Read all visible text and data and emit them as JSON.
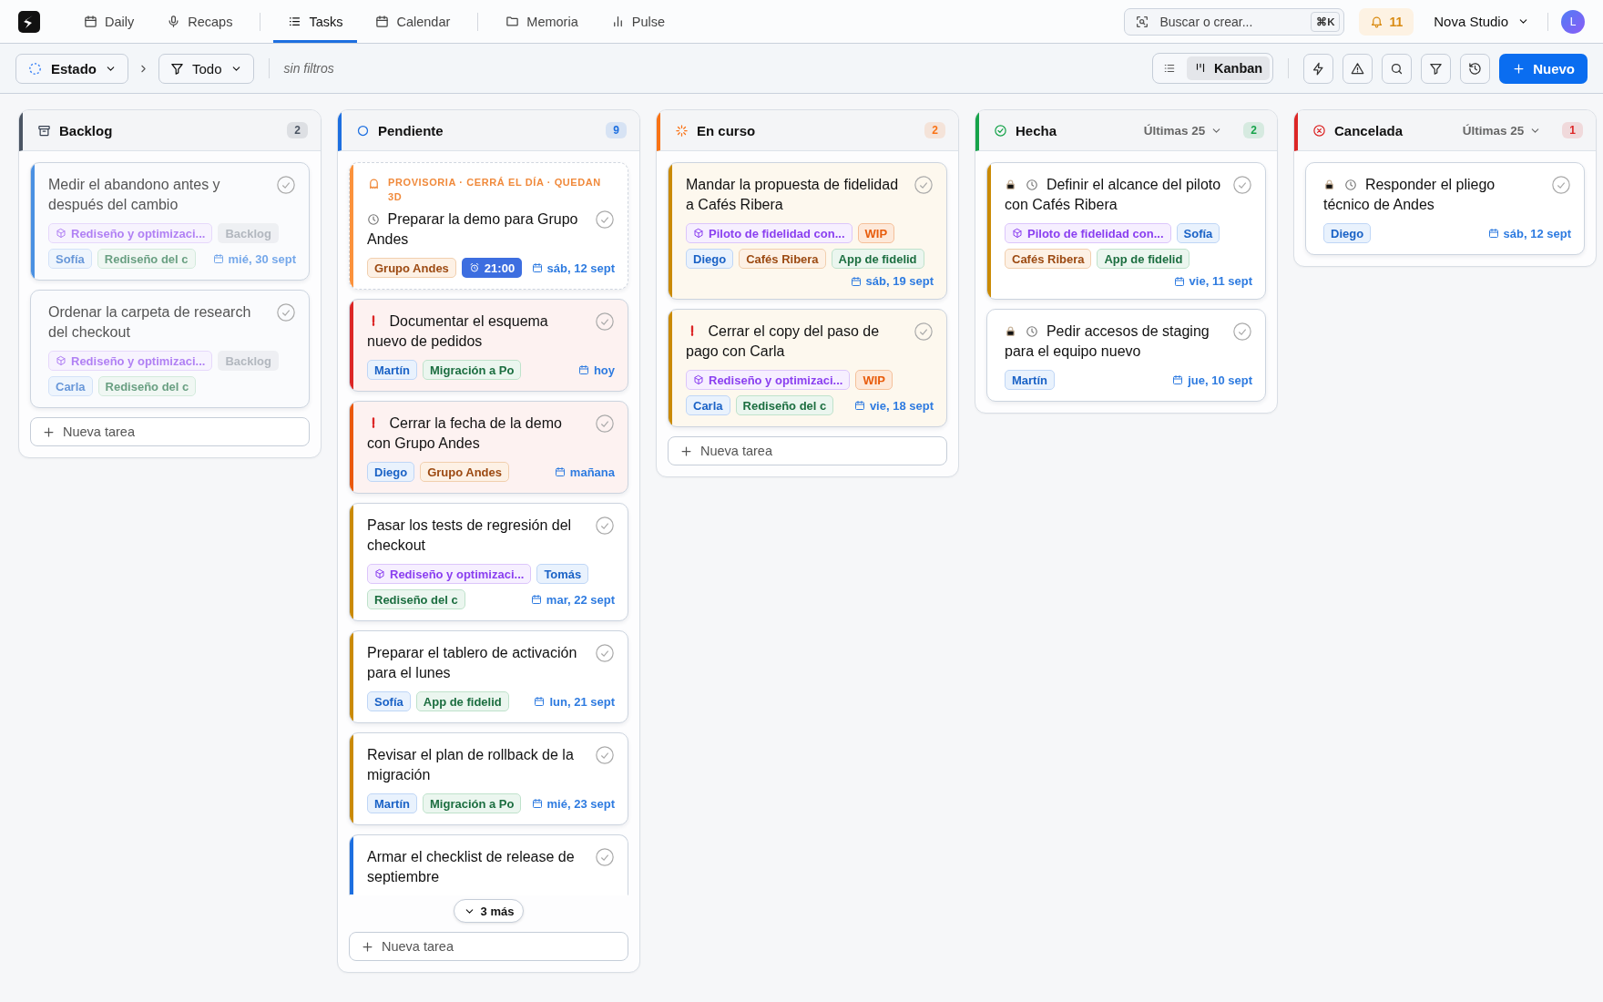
{
  "nav": {
    "tab_groups": [
      {
        "tabs": [
          {
            "label": "Daily",
            "kind": "calendar",
            "selected": false
          },
          {
            "label": "Recaps",
            "kind": "microphone",
            "selected": false
          }
        ]
      },
      {
        "tabs": [
          {
            "label": "Tasks",
            "kind": "list",
            "selected": true
          },
          {
            "label": "Calendar",
            "kind": "calendar",
            "selected": false
          }
        ]
      },
      {
        "tabs": [
          {
            "label": "Memoria",
            "kind": "folder",
            "selected": false
          },
          {
            "label": "Pulse",
            "kind": "bar-chart",
            "selected": false
          }
        ]
      }
    ],
    "search": {
      "placeholder": "Buscar o crear...",
      "shortcut": "⌘K"
    },
    "notifications": "11",
    "workspace": "Nova Studio",
    "avatar": "L"
  },
  "toolbar": {
    "state_picker": "Estado",
    "filter": "Todo",
    "filter_note": "sin filtros",
    "views": [
      {
        "kind": "list",
        "selected": false
      },
      {
        "kind": "kanban",
        "label": "Kanban",
        "selected": true
      }
    ],
    "new_button": "Nuevo"
  },
  "columns": [
    {
      "kind": "backlog",
      "title": "Backlog",
      "color": "#4b5563",
      "count": "2",
      "new_task": "Nueva tarea",
      "cards": [
        {
          "kind": "muted",
          "color": "#4a90e2",
          "urgent": false,
          "locked": false,
          "scheduled": false,
          "title": "Medir el abandono antes y después del cambio",
          "tags": [
            {
              "kind": "project",
              "label": "Rediseño y optimizaci..."
            },
            {
              "kind": "status",
              "label": "Backlog"
            },
            {
              "kind": "person",
              "label": "Sofía"
            },
            {
              "kind": "area",
              "label": "Rediseño del c"
            }
          ],
          "due": "mié, 30 sept"
        },
        {
          "kind": "muted",
          "urgent": false,
          "locked": false,
          "scheduled": false,
          "title": "Ordenar la carpeta de research del checkout",
          "tags": [
            {
              "kind": "project",
              "label": "Rediseño y optimizaci..."
            },
            {
              "kind": "status",
              "label": "Backlog"
            },
            {
              "kind": "person",
              "label": "Carla"
            },
            {
              "kind": "area",
              "label": "Rediseño del c"
            }
          ]
        }
      ]
    },
    {
      "kind": "pending",
      "title": "Pendiente",
      "color": "#1d6fe0",
      "count": "9",
      "more": "3 más",
      "new_task": "Nueva tarea",
      "cards": [
        {
          "kind": "provisional",
          "color": "#fb923c",
          "banner": "PROVISORIA · CERRÁ EL DÍA · QUEDAN 3D",
          "urgent": false,
          "locked": false,
          "scheduled": true,
          "title": "Preparar la demo para Grupo Andes",
          "tags": [
            {
              "kind": "client",
              "label": "Grupo Andes"
            },
            {
              "kind": "time",
              "label": "21:00"
            }
          ],
          "due": "sáb, 12 sept"
        },
        {
          "kind": "urgent",
          "color": "#dc2626",
          "urgent": true,
          "locked": false,
          "scheduled": false,
          "title": "Documentar el esquema nuevo de pedidos",
          "tags": [
            {
              "kind": "person",
              "label": "Martín"
            },
            {
              "kind": "area",
              "label": "Migración a Po"
            }
          ],
          "due": "hoy"
        },
        {
          "kind": "urgent",
          "color": "#ea580c",
          "urgent": true,
          "locked": false,
          "scheduled": false,
          "title": "Cerrar la fecha de la demo con Grupo Andes",
          "tags": [
            {
              "kind": "person",
              "label": "Diego"
            },
            {
              "kind": "client",
              "label": "Grupo Andes"
            }
          ],
          "due": "mañana"
        },
        {
          "kind": "plain",
          "color": "#ca8a04",
          "urgent": false,
          "locked": false,
          "scheduled": false,
          "title": "Pasar los tests de regresión del checkout",
          "tags": [
            {
              "kind": "project",
              "label": "Rediseño y optimizaci..."
            },
            {
              "kind": "person",
              "label": "Tomás"
            },
            {
              "kind": "area",
              "label": "Rediseño del c"
            }
          ],
          "due": "mar, 22 sept"
        },
        {
          "kind": "plain",
          "color": "#ca8a04",
          "urgent": false,
          "locked": false,
          "scheduled": false,
          "title": "Preparar el tablero de activación para el lunes",
          "tags": [
            {
              "kind": "person",
              "label": "Sofía"
            },
            {
              "kind": "area",
              "label": "App de fidelid"
            }
          ],
          "due": "lun, 21 sept"
        },
        {
          "kind": "plain",
          "color": "#ca8a04",
          "urgent": false,
          "locked": false,
          "scheduled": false,
          "title": "Revisar el plan de rollback de la migración",
          "tags": [
            {
              "kind": "person",
              "label": "Martín"
            },
            {
              "kind": "area",
              "label": "Migración a Po"
            }
          ],
          "due": "mié, 23 sept"
        },
        {
          "kind": "plain",
          "color": "#1d6fe0",
          "urgent": false,
          "locked": false,
          "scheduled": false,
          "title": "Armar el checklist de release de septiembre"
        }
      ]
    },
    {
      "kind": "progress",
      "title": "En curso",
      "color": "#f97316",
      "count": "2",
      "new_task": "Nueva tarea",
      "cards": [
        {
          "kind": "progress",
          "color": "#ca8a04",
          "urgent": false,
          "locked": false,
          "scheduled": false,
          "title": "Mandar la propuesta de fidelidad a Cafés Ribera",
          "tags": [
            {
              "kind": "project",
              "label": "Piloto de fidelidad con..."
            },
            {
              "kind": "wip",
              "label": "WIP"
            },
            {
              "kind": "person",
              "label": "Diego"
            },
            {
              "kind": "client",
              "label": "Cafés Ribera"
            },
            {
              "kind": "area",
              "label": "App de fidelid"
            }
          ],
          "due": "sáb, 19 sept"
        },
        {
          "kind": "progress",
          "color": "#ca8a04",
          "urgent": true,
          "locked": false,
          "scheduled": false,
          "title": "Cerrar el copy del paso de pago con Carla",
          "tags": [
            {
              "kind": "project",
              "label": "Rediseño y optimizaci..."
            },
            {
              "kind": "wip",
              "label": "WIP"
            },
            {
              "kind": "person",
              "label": "Carla"
            },
            {
              "kind": "area",
              "label": "Rediseño del c"
            }
          ],
          "due": "vie, 18 sept"
        }
      ]
    },
    {
      "kind": "done",
      "title": "Hecha",
      "color": "#16a34a",
      "range": "Últimas 25",
      "count": "2",
      "cards": [
        {
          "kind": "plain",
          "color": "#ca8a04",
          "urgent": false,
          "locked": true,
          "scheduled": true,
          "title": "Definir el alcance del piloto con Cafés Ribera",
          "tags": [
            {
              "kind": "project",
              "label": "Piloto de fidelidad con..."
            },
            {
              "kind": "person",
              "label": "Sofía"
            },
            {
              "kind": "client",
              "label": "Cafés Ribera"
            },
            {
              "kind": "area",
              "label": "App de fidelid"
            }
          ],
          "due": "vie, 11 sept"
        },
        {
          "kind": "plain",
          "urgent": false,
          "locked": true,
          "scheduled": true,
          "title": "Pedir accesos de staging para el equipo nuevo",
          "tags": [
            {
              "kind": "person",
              "label": "Martín"
            }
          ],
          "due": "jue, 10 sept"
        }
      ]
    },
    {
      "kind": "cancelled",
      "title": "Cancelada",
      "color": "#dc2626",
      "range": "Últimas 25",
      "count": "1",
      "cards": [
        {
          "kind": "plain",
          "urgent": false,
          "locked": true,
          "scheduled": true,
          "title": "Responder el pliego técnico de Andes",
          "tags": [
            {
              "kind": "person",
              "label": "Diego"
            }
          ],
          "due": "sáb, 12 sept"
        }
      ]
    }
  ]
}
